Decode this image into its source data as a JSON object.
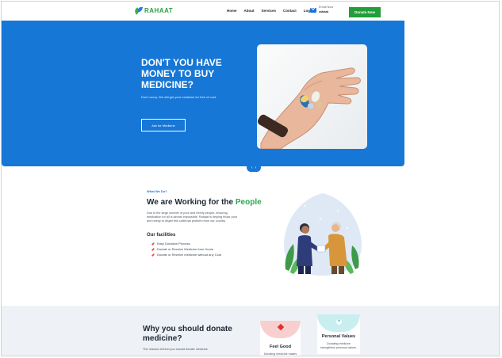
{
  "nav": {
    "logo": "RAHAAT",
    "links": [
      "Home",
      "About",
      "Services",
      "Contact",
      "Login"
    ],
    "mail_label": "Email Now",
    "mail_value": "rahaat",
    "donate_label": "Donate Now"
  },
  "hero": {
    "title": "DON'T YOU HAVE MONEY TO BUY MEDICINE?",
    "text": "Don't worry. We will get your medicine for free of cost",
    "button": "Ask for Medicine",
    "slider_prev": "‹",
    "slider_next": "›"
  },
  "about": {
    "eyebrow": "What We Do?",
    "title_main": "We are Working for the ",
    "title_accent": "People",
    "paragraph": "Due to the large number of poor and needy people, ensuring medication for all is almost impossible. Rahaat is helping those poor and needy to dispel this cutthroat problem from our country.",
    "facilities_title": "Our facilities",
    "facilities": [
      "Easy Donation Process",
      "Donate or Receive Medicine from Home",
      "Donate or Receive medicine without any Cost"
    ]
  },
  "why": {
    "title": "Why you should donate medicine?",
    "subtitle": "The reasons behind you should donate medicine.",
    "cards": [
      {
        "title": "Feel Good",
        "text": "Donating medicine makes"
      },
      {
        "title": "Personal Values",
        "text": "Donating medicine strengthens personal values."
      }
    ]
  },
  "colors": {
    "brand_blue": "#1777d6",
    "brand_green": "#229e3a",
    "accent_green": "#2fa84f"
  }
}
